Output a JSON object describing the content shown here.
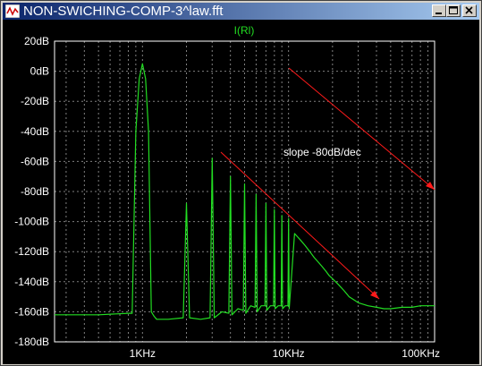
{
  "window": {
    "title": "NON-SWICHING-COMP-3^law.fft",
    "controls": {
      "minimize": "minimize",
      "maximize": "maximize",
      "close": "close"
    }
  },
  "colors": {
    "trace": "#22dd22",
    "annotation": "#ff1a1a",
    "axis_text": "#ffffff",
    "grid": "#808080",
    "background": "#000000"
  },
  "chart_data": {
    "type": "line",
    "title": "I(Rl)",
    "xlabel": "",
    "ylabel": "",
    "x_scale": "log",
    "xlim": [
      250,
      100000
    ],
    "ylim": [
      -180,
      20
    ],
    "y_ticks": [
      20,
      0,
      -20,
      -40,
      -60,
      -80,
      -100,
      -120,
      -140,
      -160,
      -180
    ],
    "y_tick_labels": [
      "20dB",
      "0dB",
      "-20dB",
      "-40dB",
      "-60dB",
      "-80dB",
      "-100dB",
      "-120dB",
      "-140dB",
      "-160dB",
      "-180dB"
    ],
    "x_ticks": [
      1000,
      10000,
      100000
    ],
    "x_tick_labels": [
      "1KHz",
      "10KHz",
      "100KHz"
    ],
    "grid": true,
    "series": [
      {
        "name": "I(Rl)",
        "x": [
          250,
          500,
          800,
          850,
          900,
          950,
          1000,
          1050,
          1100,
          1150,
          1200,
          1250,
          1500,
          1900,
          2000,
          2100,
          2500,
          2900,
          3000,
          3100,
          3500,
          3900,
          4000,
          4100,
          4500,
          4900,
          5000,
          5100,
          5500,
          5900,
          6000,
          6100,
          6500,
          6900,
          7000,
          7100,
          7500,
          7900,
          8000,
          8100,
          8500,
          8900,
          9000,
          9100,
          9500,
          9900,
          10000,
          10100,
          11000,
          12000,
          13000,
          14000,
          15000,
          16000,
          17000,
          18000,
          19000,
          20000,
          22000,
          24000,
          26000,
          28000,
          30000,
          35000,
          40000,
          45000,
          50000,
          60000,
          70000,
          80000,
          90000,
          100000
        ],
        "y": [
          -162,
          -162,
          -161,
          -161,
          -40,
          -5,
          5,
          -5,
          -40,
          -160,
          -163,
          -165,
          -165,
          -164,
          -88,
          -164,
          -165,
          -164,
          -58,
          -164,
          -160,
          -161,
          -70,
          -162,
          -158,
          -159,
          -75,
          -161,
          -156,
          -157,
          -82,
          -160,
          -156,
          -156,
          -88,
          -159,
          -156,
          -156,
          -92,
          -158,
          -156,
          -156,
          -96,
          -158,
          -156,
          -156,
          -98,
          -158,
          -108,
          -112,
          -116,
          -120,
          -124,
          -127,
          -130,
          -133,
          -136,
          -138,
          -142,
          -146,
          -150,
          -152,
          -154,
          -156,
          -157,
          -158,
          -158,
          -157,
          -157,
          -156,
          -156,
          -156
        ]
      }
    ],
    "annotations": [
      {
        "text": "slope -80dB/dec"
      }
    ]
  }
}
